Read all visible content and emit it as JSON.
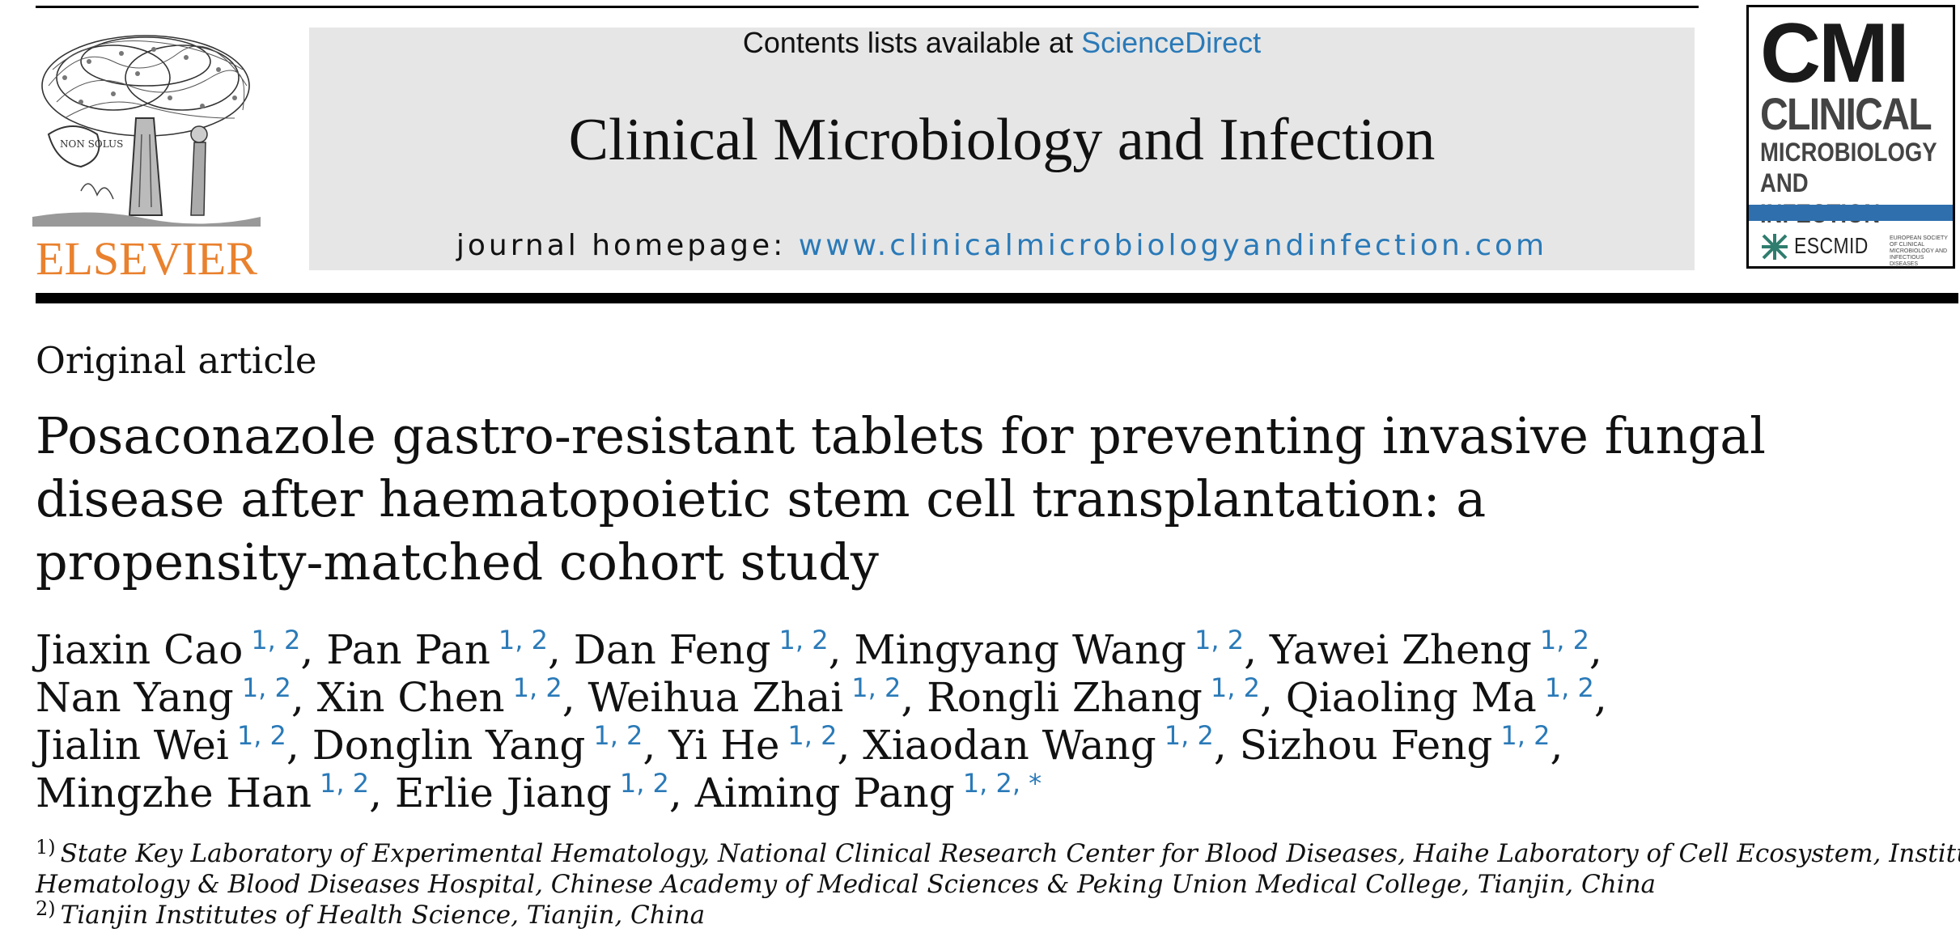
{
  "header": {
    "publisher_logo_text": "ELSEVIER",
    "contents_prefix": "Contents lists available at ",
    "contents_link": "ScienceDirect",
    "journal_name": "Clinical Microbiology and Infection",
    "homepage_prefix": "journal homepage: ",
    "homepage_url": "www.clinicalmicrobiologyandinfection.com",
    "cover": {
      "big": "CMI",
      "line1": "CLINICAL",
      "line2": "MICROBIOLOGY",
      "line3": "AND INFECTION",
      "society": "ESCMID",
      "society_sub": "EUROPEAN SOCIETY OF CLINICAL MICROBIOLOGY AND INFECTIOUS DISEASES"
    },
    "colors": {
      "link": "#2a7ab8",
      "elsevier_orange": "#e9812e",
      "banner_gray": "#e6e6e6",
      "cover_blue": "#2f6fae"
    }
  },
  "article": {
    "type": "Original article",
    "title_lines": [
      "Posaconazole gastro-resistant tablets for preventing invasive fungal",
      "disease after haematopoietic stem cell transplantation: a",
      "propensity-matched cohort study"
    ],
    "authors": [
      {
        "name": "Jiaxin Cao",
        "aff": "1, 2",
        "sep": ","
      },
      {
        "name": "Pan Pan",
        "aff": "1, 2",
        "sep": ","
      },
      {
        "name": "Dan Feng",
        "aff": "1, 2",
        "sep": ","
      },
      {
        "name": "Mingyang Wang",
        "aff": "1, 2",
        "sep": ","
      },
      {
        "name": "Yawei Zheng",
        "aff": "1, 2",
        "sep": ","
      },
      {
        "name": "Nan Yang",
        "aff": "1, 2",
        "sep": ","
      },
      {
        "name": "Xin Chen",
        "aff": "1, 2",
        "sep": ","
      },
      {
        "name": "Weihua Zhai",
        "aff": "1, 2",
        "sep": ","
      },
      {
        "name": "Rongli Zhang",
        "aff": "1, 2",
        "sep": ","
      },
      {
        "name": "Qiaoling Ma",
        "aff": "1, 2",
        "sep": ","
      },
      {
        "name": "Jialin Wei",
        "aff": "1, 2",
        "sep": ","
      },
      {
        "name": "Donglin Yang",
        "aff": "1, 2",
        "sep": ","
      },
      {
        "name": "Yi He",
        "aff": "1, 2",
        "sep": ","
      },
      {
        "name": "Xiaodan Wang",
        "aff": "1, 2",
        "sep": ","
      },
      {
        "name": "Sizhou Feng",
        "aff": "1, 2",
        "sep": ","
      },
      {
        "name": "Mingzhe Han",
        "aff": "1, 2",
        "sep": ","
      },
      {
        "name": "Erlie Jiang",
        "aff": "1, 2",
        "sep": ","
      },
      {
        "name": "Aiming Pang",
        "aff": "1, 2, *",
        "sep": ""
      }
    ],
    "affiliations": [
      {
        "num": "1)",
        "lines": [
          "State Key Laboratory of Experimental Hematology, National Clinical Research Center for Blood Diseases, Haihe Laboratory of Cell Ecosystem, Institute of",
          "Hematology & Blood Diseases Hospital, Chinese Academy of Medical Sciences & Peking Union Medical College, Tianjin, China"
        ]
      },
      {
        "num": "2)",
        "lines": [
          "Tianjin Institutes of Health Science, Tianjin, China"
        ]
      }
    ]
  }
}
